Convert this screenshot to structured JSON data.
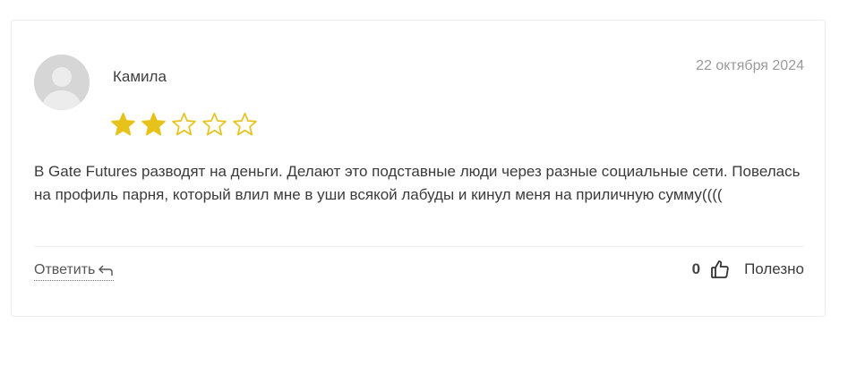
{
  "review": {
    "author": "Камила",
    "date": "22 октября 2024",
    "rating": 2,
    "max_rating": 5,
    "text": "В Gate Futures разводят на деньги. Делают это подставные люди через разные социальные сети. Повелась на профиль парня, который влил мне в уши всякой лабуды и кинул меня на приличную сумму((((",
    "reply_label": "Ответить",
    "helpful_count": "0",
    "helpful_label": "Полезно"
  },
  "colors": {
    "star_filled": "#e6c21a",
    "star_empty_outline": "#e6c21a",
    "avatar_bg": "#d6d6d6"
  },
  "icons": {
    "avatar": "user-silhouette-icon",
    "star": "star-icon",
    "reply": "reply-arrow-icon",
    "helpful": "thumbs-up-icon"
  }
}
